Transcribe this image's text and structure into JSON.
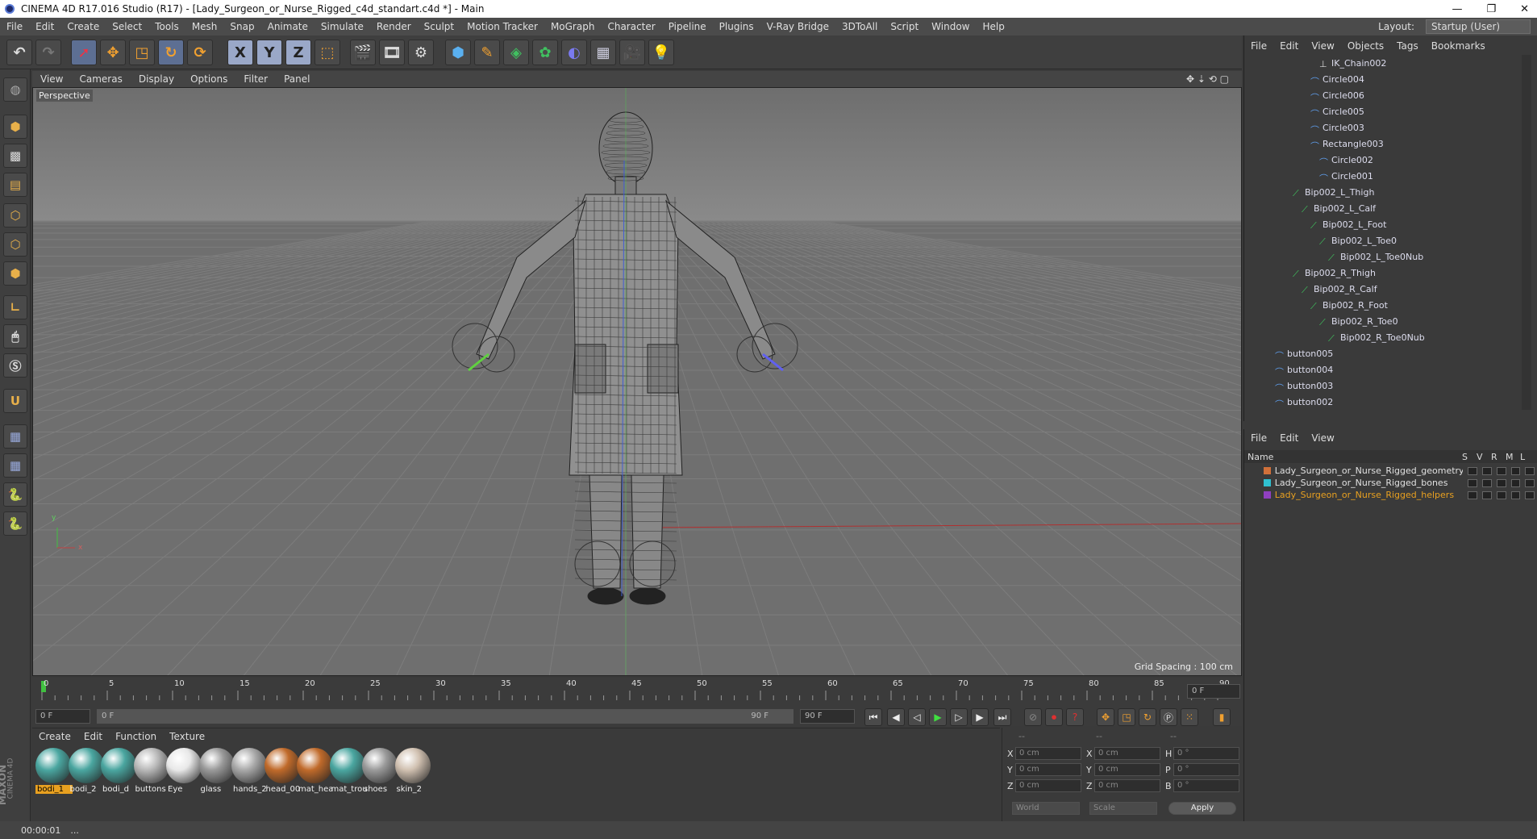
{
  "window": {
    "title": "CINEMA 4D R17.016 Studio (R17) - [Lady_Surgeon_or_Nurse_Rigged_c4d_standart.c4d *] - Main",
    "controls": [
      "—",
      "❐",
      "✕"
    ]
  },
  "menubar": {
    "items": [
      "File",
      "Edit",
      "Create",
      "Select",
      "Tools",
      "Mesh",
      "Snap",
      "Animate",
      "Simulate",
      "Render",
      "Sculpt",
      "Motion Tracker",
      "MoGraph",
      "Character",
      "Pipeline",
      "Plugins",
      "V-Ray Bridge",
      "3DToAll",
      "Script",
      "Window",
      "Help"
    ],
    "layout_label": "Layout:",
    "layout_value": "Startup (User)"
  },
  "toolbar": {
    "icons": [
      "undo-icon",
      "redo-icon",
      "select-arrow-icon",
      "move-icon",
      "scale-icon",
      "rotate-icon",
      "rotate2-icon",
      "axis-x-icon",
      "axis-y-icon",
      "axis-z-icon",
      "coordinate-system-icon",
      "render-view-icon",
      "render-picture-viewer-icon",
      "render-settings-icon",
      "cube-icon",
      "pen-spline-icon",
      "subdivision-icon",
      "cloner-icon",
      "deformer-icon",
      "floor-grid-icon",
      "camera-icon",
      "light-icon"
    ],
    "axis_x": "X",
    "axis_y": "Y",
    "axis_z": "Z"
  },
  "viewport": {
    "menu": [
      "View",
      "Cameras",
      "Display",
      "Options",
      "Filter",
      "Panel"
    ],
    "label": "Perspective",
    "grid_spacing": "Grid Spacing : 100 cm",
    "axis_y": "y",
    "axis_x": "x",
    "accent_wire": "#c8c8c8"
  },
  "timeline": {
    "ticks": [
      "0",
      "5",
      "10",
      "15",
      "20",
      "25",
      "30",
      "35",
      "40",
      "45",
      "50",
      "55",
      "60",
      "65",
      "70",
      "75",
      "80",
      "85",
      "90"
    ],
    "current_frame_field": "0 F",
    "start_field": "0 F",
    "range_start": "0 F",
    "range_end": "90 F",
    "end_field": "90 F"
  },
  "materials": {
    "menu": [
      "Create",
      "Edit",
      "Function",
      "Texture"
    ],
    "items": [
      {
        "label": "bodi_1",
        "color": "#4aa6a0",
        "selected": true
      },
      {
        "label": "bodi_2",
        "color": "#4aa6a0",
        "selected": false
      },
      {
        "label": "bodi_d",
        "color": "#4aa6a0",
        "selected": false
      },
      {
        "label": "buttons",
        "color": "#b8b8b8",
        "selected": false
      },
      {
        "label": "Eye",
        "color": "#e8e8e8",
        "selected": false
      },
      {
        "label": "glass",
        "color": "#999999",
        "selected": false
      },
      {
        "label": "hands_2",
        "color": "#a8a8a8",
        "selected": false
      },
      {
        "label": "head_00",
        "color": "#c06a2a",
        "selected": false
      },
      {
        "label": "mat_hea",
        "color": "#c06a2a",
        "selected": false
      },
      {
        "label": "mat_trou",
        "color": "#4aa6a0",
        "selected": false
      },
      {
        "label": "shoes",
        "color": "#9a9a9a",
        "selected": false
      },
      {
        "label": "skin_2",
        "color": "#d0c0b0",
        "selected": false
      }
    ]
  },
  "coordinates": {
    "headers": [
      "--",
      "--",
      "--"
    ],
    "rows": [
      {
        "l1": "X",
        "v1": "0 cm",
        "l2": "X",
        "v2": "0 cm",
        "l3": "H",
        "v3": "0 °"
      },
      {
        "l1": "Y",
        "v1": "0 cm",
        "l2": "Y",
        "v2": "0 cm",
        "l3": "P",
        "v3": "0 °"
      },
      {
        "l1": "Z",
        "v1": "0 cm",
        "l2": "Z",
        "v2": "0 cm",
        "l3": "B",
        "v3": "0 °"
      }
    ],
    "world": "World",
    "scale": "Scale",
    "apply": "Apply"
  },
  "objects": {
    "menu": [
      "File",
      "Edit",
      "View",
      "Objects",
      "Tags",
      "Bookmarks"
    ],
    "rows": [
      {
        "label": "IK_Chain002",
        "indent": 5,
        "type": "ik"
      },
      {
        "label": "Circle004",
        "indent": 4,
        "type": "spline"
      },
      {
        "label": "Circle006",
        "indent": 4,
        "type": "spline"
      },
      {
        "label": "Circle005",
        "indent": 4,
        "type": "spline"
      },
      {
        "label": "Circle003",
        "indent": 4,
        "type": "spline"
      },
      {
        "label": "Rectangle003",
        "indent": 4,
        "type": "spline"
      },
      {
        "label": "Circle002",
        "indent": 5,
        "type": "spline"
      },
      {
        "label": "Circle001",
        "indent": 5,
        "type": "spline"
      },
      {
        "label": "Bip002_L_Thigh",
        "indent": 2,
        "type": "bone"
      },
      {
        "label": "Bip002_L_Calf",
        "indent": 3,
        "type": "bone"
      },
      {
        "label": "Bip002_L_Foot",
        "indent": 4,
        "type": "bone"
      },
      {
        "label": "Bip002_L_Toe0",
        "indent": 5,
        "type": "bone"
      },
      {
        "label": "Bip002_L_Toe0Nub",
        "indent": 6,
        "type": "bone"
      },
      {
        "label": "Bip002_R_Thigh",
        "indent": 2,
        "type": "bone"
      },
      {
        "label": "Bip002_R_Calf",
        "indent": 3,
        "type": "bone"
      },
      {
        "label": "Bip002_R_Foot",
        "indent": 4,
        "type": "bone"
      },
      {
        "label": "Bip002_R_Toe0",
        "indent": 5,
        "type": "bone"
      },
      {
        "label": "Bip002_R_Toe0Nub",
        "indent": 6,
        "type": "bone"
      },
      {
        "label": "button005",
        "indent": 0,
        "type": "spline"
      },
      {
        "label": "button004",
        "indent": 0,
        "type": "spline"
      },
      {
        "label": "button003",
        "indent": 0,
        "type": "spline"
      },
      {
        "label": "button002",
        "indent": 0,
        "type": "spline"
      }
    ]
  },
  "layers": {
    "menu": [
      "File",
      "Edit",
      "View"
    ],
    "header_name": "Name",
    "header_cols": [
      "S",
      "V",
      "R",
      "M",
      "L"
    ],
    "rows": [
      {
        "label": "Lady_Surgeon_or_Nurse_Rigged_geometry",
        "color": "#d0703a",
        "text": "#e0e0e0"
      },
      {
        "label": "Lady_Surgeon_or_Nurse_Rigged_bones",
        "color": "#30c0d0",
        "text": "#e0e0e0"
      },
      {
        "label": "Lady_Surgeon_or_Nurse_Rigged_helpers",
        "color": "#9040c0",
        "text": "#e8a020"
      }
    ]
  },
  "status": {
    "time": "00:00:01",
    "msg": "..."
  },
  "maxon": {
    "line1": "MAXON",
    "line2": "CINEMA 4D"
  }
}
